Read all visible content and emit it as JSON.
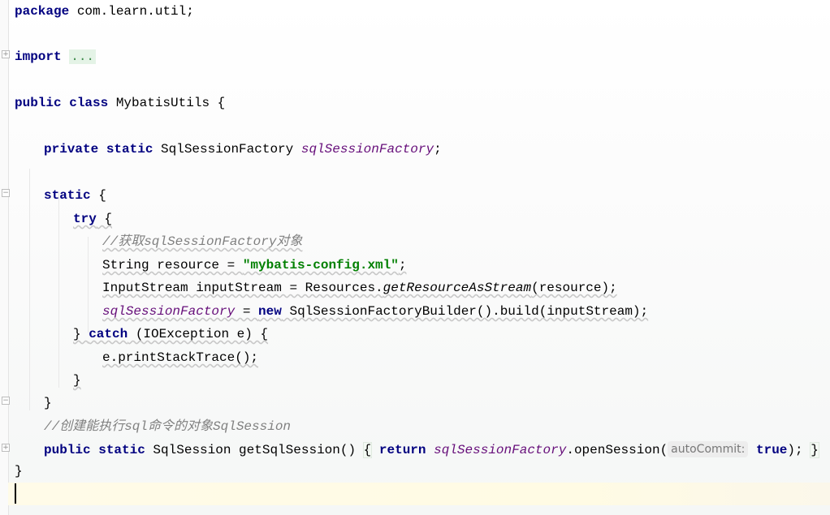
{
  "code": {
    "pkg_kw": "package",
    "pkg_name": " com.learn.util;",
    "import_kw": "import",
    "import_fold": "...",
    "class_kw": "public class",
    "class_name": " MybatisUtils {",
    "field_kw": "private static",
    "field_type": " SqlSessionFactory ",
    "field_name": "sqlSessionFactory",
    "field_end": ";",
    "static_kw": "static",
    "static_open": " {",
    "try_kw": "try",
    "try_open": " {",
    "comment1": "//获取sqlSessionFactory对象",
    "res_decl": "String resource = ",
    "res_value": "\"mybatis-config.xml\"",
    "res_end": ";",
    "is_decl": "InputStream inputStream = Resources.",
    "is_method": "getResourceAsStream",
    "is_args": "(resource);",
    "assign_field": "sqlSessionFactory",
    "assign_eq": " = ",
    "new_kw": "new",
    "assign_rest": " SqlSessionFactoryBuilder().build(inputStream);",
    "catch_open": "} ",
    "catch_kw": "catch",
    "catch_rest": " (IOException e) {",
    "print_stack": "e.printStackTrace();",
    "close_brace": "}",
    "comment2": "//创建能执行sql命令的对象SqlSession",
    "method_kw": "public static",
    "method_sig": " SqlSession getSqlSession() ",
    "method_open": "{",
    "return_kw": "return",
    "return_field": "sqlSessionFactory",
    "open_session": ".openSession(",
    "param_hint": "autoCommit:",
    "true_kw": "true",
    "method_end": ");",
    "method_close": "}"
  }
}
